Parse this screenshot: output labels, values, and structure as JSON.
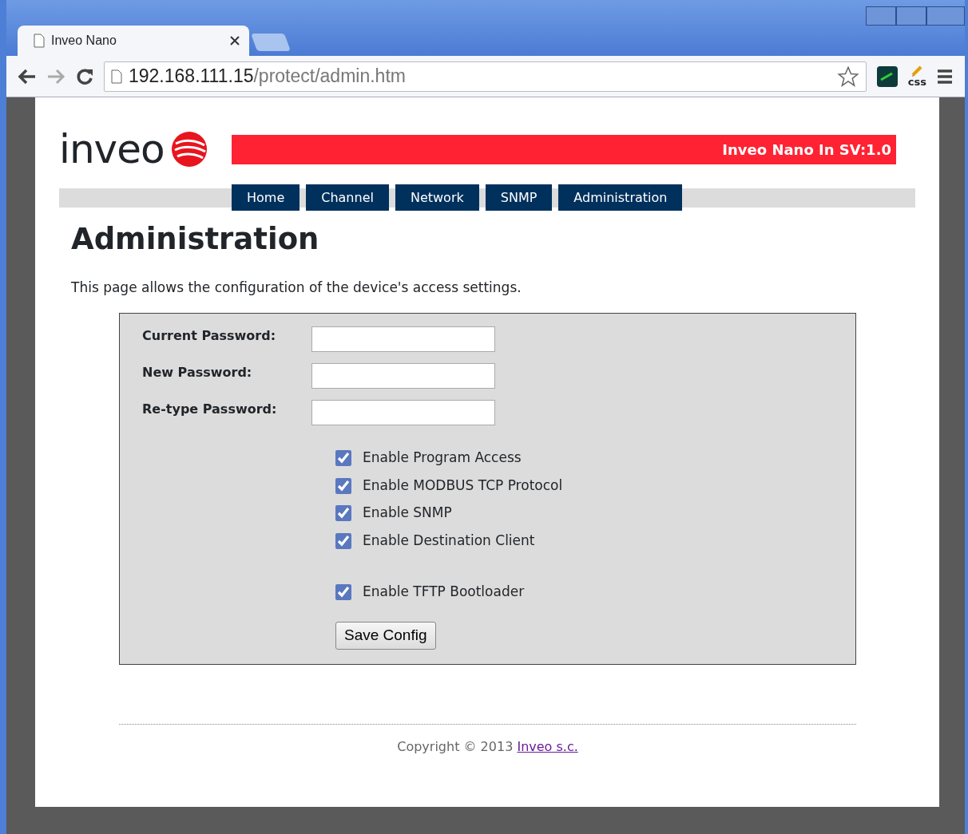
{
  "browser": {
    "tab_title": "Inveo Nano",
    "url_host": "192.168.111.15",
    "url_path": "/protect/admin.htm",
    "extension_label": "css"
  },
  "header": {
    "logo": "inveo",
    "banner": "Inveo Nano In SV:1.0"
  },
  "nav": [
    {
      "label": "Home"
    },
    {
      "label": "Channel"
    },
    {
      "label": "Network"
    },
    {
      "label": "SNMP"
    },
    {
      "label": "Administration"
    }
  ],
  "heading": "Administration",
  "intro": "This page allows the configuration of the device's access settings.",
  "fields": [
    {
      "label": "Current Password:"
    },
    {
      "label": "New Password:"
    },
    {
      "label": "Re-type Password:"
    }
  ],
  "option_groups": [
    [
      {
        "label": "Enable Program Access",
        "checked": true
      },
      {
        "label": "Enable MODBUS TCP Protocol",
        "checked": true
      },
      {
        "label": "Enable SNMP",
        "checked": true
      },
      {
        "label": "Enable Destination Client",
        "checked": true
      }
    ],
    [
      {
        "label": "Enable TFTP Bootloader",
        "checked": true
      }
    ]
  ],
  "save_button": "Save Config",
  "footer": {
    "text": "Copyright © 2013",
    "link": "Inveo s.c."
  }
}
